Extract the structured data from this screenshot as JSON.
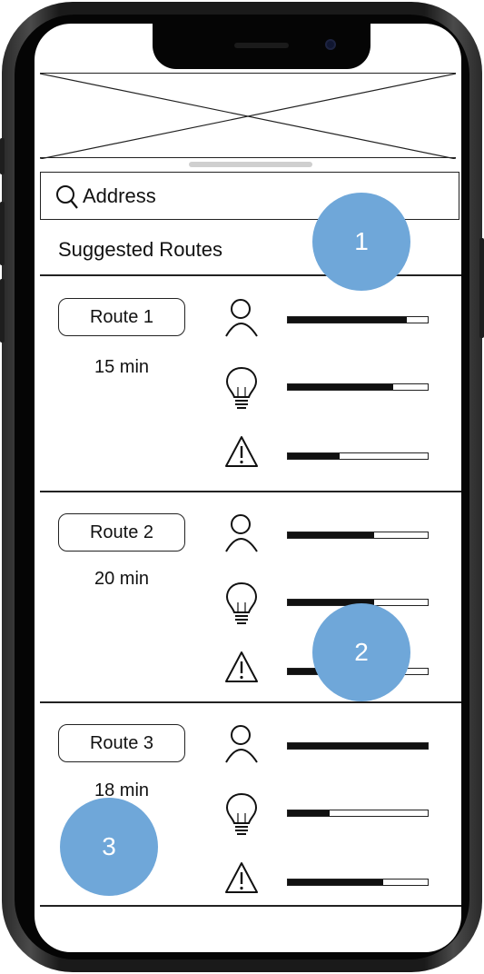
{
  "search": {
    "value": "Address",
    "icon": "search-icon"
  },
  "suggested": {
    "title": "Suggested Routes"
  },
  "routes": [
    {
      "label": "Route 1",
      "duration": "15 min",
      "metrics": {
        "walk": 0.85,
        "light": 0.75,
        "hazard": 0.37
      }
    },
    {
      "label": "Route 2",
      "duration": "20 min",
      "metrics": {
        "walk": 0.62,
        "light": 0.62,
        "hazard": 0.55
      }
    },
    {
      "label": "Route 3",
      "duration": "18 min",
      "metrics": {
        "walk": 1.0,
        "light": 0.3,
        "hazard": 0.68
      }
    }
  ],
  "metric_icons": [
    "person-icon",
    "lightbulb-icon",
    "warning-icon"
  ],
  "annotations": [
    "1",
    "2",
    "3"
  ],
  "colors": {
    "annotation": "#6fa7d9",
    "bar_fill": "#111111"
  }
}
